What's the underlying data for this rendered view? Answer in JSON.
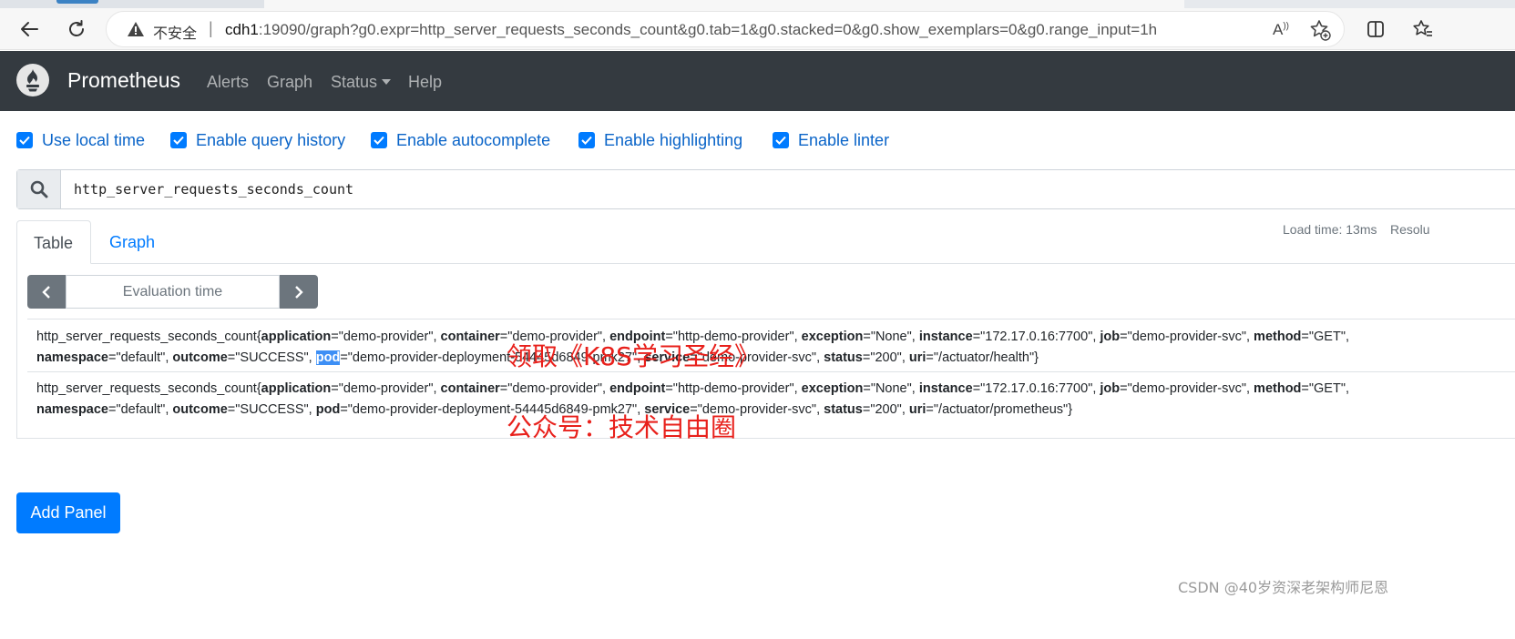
{
  "browser": {
    "insecure_label": "不安全",
    "separator": "|",
    "url_host": "cdh1",
    "url_rest": ":19090/graph?g0.expr=http_server_requests_seconds_count&g0.tab=1&g0.stacked=0&g0.show_exemplars=0&g0.range_input=1h",
    "read_aloud_label": "A",
    "icons": [
      "back-icon",
      "reload-icon",
      "warning-icon",
      "read-aloud-icon",
      "favorite-add-icon",
      "split-screen-icon",
      "favorites-icon"
    ]
  },
  "navbar": {
    "brand": "Prometheus",
    "links": [
      "Alerts",
      "Graph",
      "Status",
      "Help"
    ]
  },
  "options": [
    {
      "label": "Use local time",
      "checked": true
    },
    {
      "label": "Enable query history",
      "checked": true
    },
    {
      "label": "Enable autocomplete",
      "checked": true
    },
    {
      "label": "Enable highlighting",
      "checked": true
    },
    {
      "label": "Enable linter",
      "checked": true
    }
  ],
  "query": {
    "expression": "http_server_requests_seconds_count"
  },
  "panel": {
    "tabs": [
      "Table",
      "Graph"
    ],
    "active_tab": "Table",
    "load_time": "Load time: 13ms",
    "resolution": "Resolu",
    "evaluation_time_placeholder": "Evaluation time",
    "results": [
      {
        "metric": "http_server_requests_seconds_count{",
        "labels": [
          {
            "k": "application",
            "v": "\"demo-provider\""
          },
          {
            "k": "container",
            "v": "\"demo-provider\""
          },
          {
            "k": "endpoint",
            "v": "\"http-demo-provider\""
          },
          {
            "k": "exception",
            "v": "\"None\""
          },
          {
            "k": "instance",
            "v": "\"172.17.0.16:7700\""
          },
          {
            "k": "job",
            "v": "\"demo-provider-svc\""
          },
          {
            "k": "method",
            "v": "\"GET\""
          },
          {
            "k": "namespace",
            "v": "\"default\""
          },
          {
            "k": "outcome",
            "v": "\"SUCCESS\""
          },
          {
            "k": "pod",
            "v": "\"demo-provider-deployment-54445d6849-pmk27\""
          },
          {
            "k": "service",
            "v": "\"demo-provider-svc\""
          },
          {
            "k": "status",
            "v": "\"200\""
          },
          {
            "k": "uri",
            "v": "\"/actuator/health\""
          }
        ],
        "closing": "}"
      },
      {
        "metric": "http_server_requests_seconds_count{",
        "labels": [
          {
            "k": "application",
            "v": "\"demo-provider\""
          },
          {
            "k": "container",
            "v": "\"demo-provider\""
          },
          {
            "k": "endpoint",
            "v": "\"http-demo-provider\""
          },
          {
            "k": "exception",
            "v": "\"None\""
          },
          {
            "k": "instance",
            "v": "\"172.17.0.16:7700\""
          },
          {
            "k": "job",
            "v": "\"demo-provider-svc\""
          },
          {
            "k": "method",
            "v": "\"GET\""
          },
          {
            "k": "namespace",
            "v": "\"default\""
          },
          {
            "k": "outcome",
            "v": "\"SUCCESS\""
          },
          {
            "k": "pod",
            "v": "\"demo-provider-deployment-54445d6849-pmk27\""
          },
          {
            "k": "service",
            "v": "\"demo-provider-svc\""
          },
          {
            "k": "status",
            "v": "\"200\""
          },
          {
            "k": "uri",
            "v": "\"/actuator/prometheus\""
          }
        ],
        "closing": "}"
      }
    ]
  },
  "add_panel_label": "Add Panel",
  "watermarks": {
    "line1": "领取《K8S学习圣经》",
    "line2": "公众号：技术自由圈"
  },
  "csdn_credit": "CSDN @40岁资深老架构师尼恩",
  "colors": {
    "navbar": "#343a40",
    "primary": "#007bff",
    "secondary": "#6c757d",
    "watermark": "#e8201b"
  }
}
